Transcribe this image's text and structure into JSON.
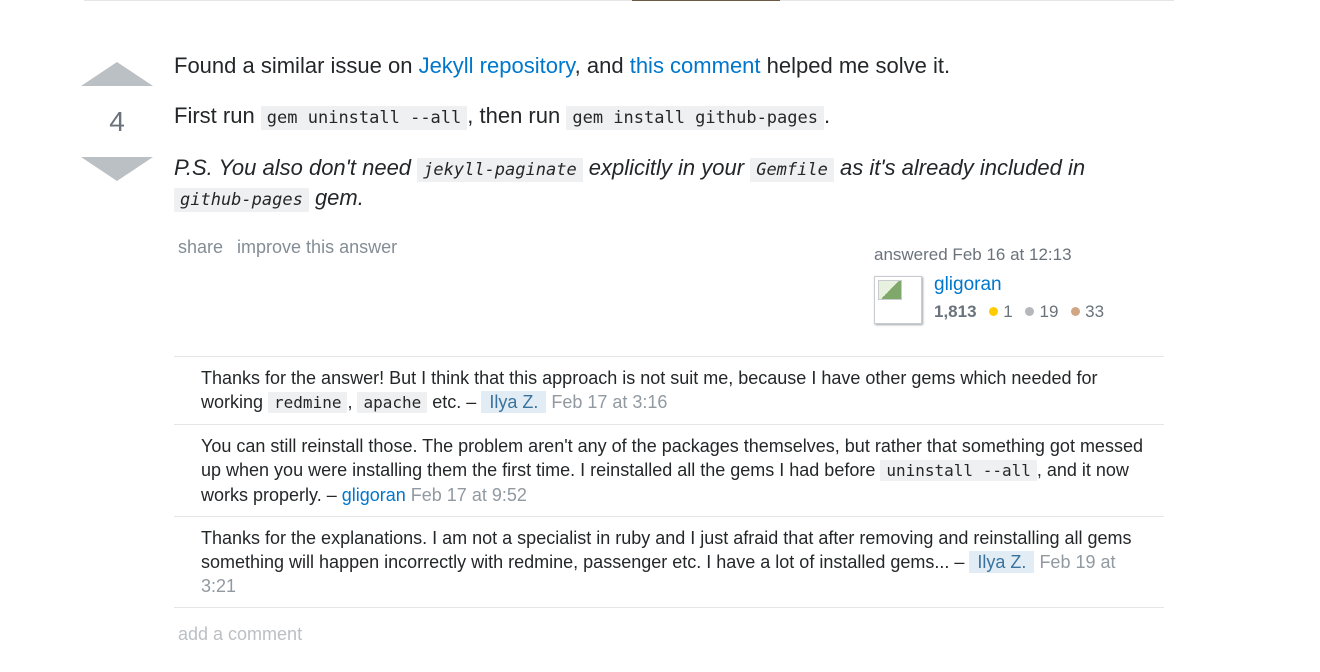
{
  "vote": {
    "count": "4",
    "up_icon": "arrow-up-icon",
    "down_icon": "arrow-down-icon"
  },
  "answer": {
    "line1": {
      "before": "Found a similar issue on ",
      "link1": "Jekyll repository",
      "middle": ", and ",
      "link2": "this comment",
      "after": " helped me solve it."
    },
    "line2": {
      "before": "First run ",
      "code1": "gem uninstall --all",
      "middle": ", then run ",
      "code2": "gem install github-pages",
      "after": "."
    },
    "line3": {
      "before": "P.S. You also don't need ",
      "code1": "jekyll-paginate",
      "middle1": " explicitly in your ",
      "code2": "Gemfile",
      "middle2": " as it's already included in ",
      "code3": "github-pages",
      "after": " gem."
    }
  },
  "post_menu": {
    "share": "share",
    "improve": "improve this answer"
  },
  "user_card": {
    "action": "answered Feb 16 at 12:13",
    "name": "gligoran",
    "reputation": "1,813",
    "gold": "1",
    "silver": "19",
    "bronze": "33",
    "colors": {
      "gold": "#ffcc01",
      "silver": "#b4b8bc",
      "bronze": "#d1a684"
    }
  },
  "comments": [
    {
      "text_before": "Thanks for the answer! But I think that this approach is not suit me, because I have other gems which needed for working ",
      "code1": "redmine",
      "middle": ", ",
      "code2": "apache",
      "text_after": " etc. – ",
      "user": "Ilya Z.",
      "date": "Feb 17 at 3:16"
    },
    {
      "text_before": "You can still reinstall those. The problem aren't any of the packages themselves, but rather that something got messed up when you were installing them the first time. I reinstalled all the gems I had before ",
      "code1": "uninstall --all",
      "text_after": ", and it now works properly. – ",
      "user": "gligoran",
      "date": "Feb 17 at 9:52"
    },
    {
      "text_before": "Thanks for the explanations. I am not a specialist in ruby and I just afraid that after removing and reinstalling all gems something will happen incorrectly with redmine, passenger etc. I have a lot of installed gems... – ",
      "user": "Ilya Z.",
      "date": "Feb 19 at 3:21"
    }
  ],
  "add_comment": "add a comment"
}
